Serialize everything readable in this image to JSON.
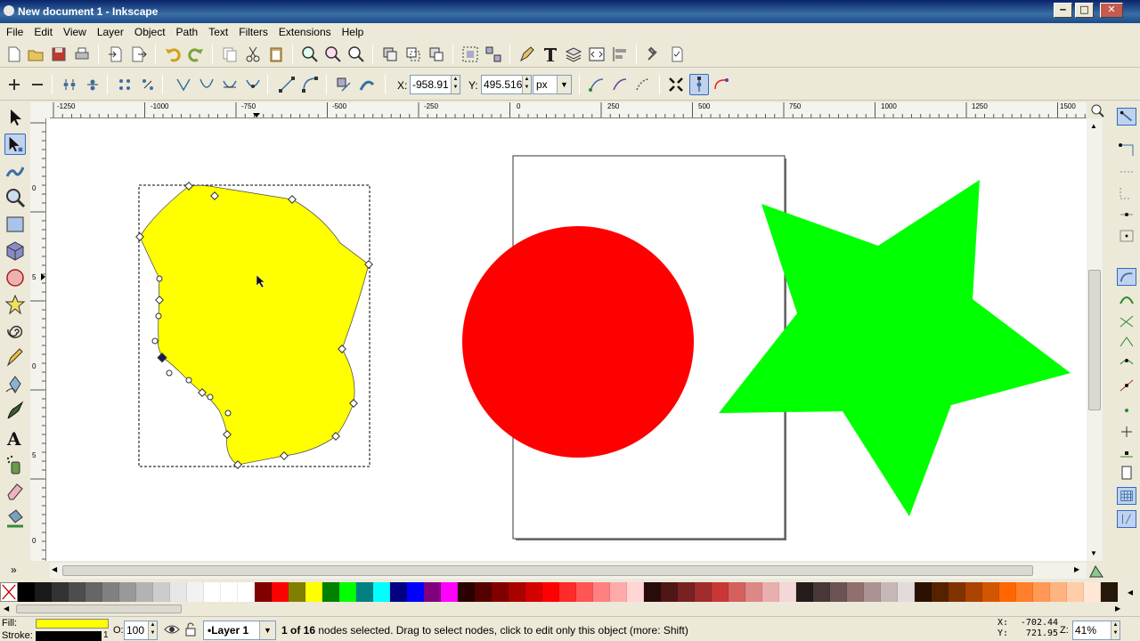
{
  "window": {
    "title": "New document 1 - Inkscape"
  },
  "menu": [
    "File",
    "Edit",
    "View",
    "Layer",
    "Object",
    "Path",
    "Text",
    "Filters",
    "Extensions",
    "Help"
  ],
  "node_toolbar": {
    "x_label": "X:",
    "x_value": "-958.91",
    "y_label": "Y:",
    "y_value": "495.516",
    "unit": "px"
  },
  "rulers": {
    "top_ticks": [
      "-1250",
      "-1000",
      "-750",
      "-500",
      "-250",
      "0",
      "250",
      "500",
      "750",
      "1000",
      "1250",
      "1500"
    ],
    "left_ticks": [
      "0",
      "5",
      "0",
      "5",
      "0"
    ]
  },
  "colors": {
    "yellow_shape": "#ffff00",
    "circle": "#ff0000",
    "star": "#00ff00",
    "selection": "#316ac5"
  },
  "palette": [
    "#000000",
    "#1a1a1a",
    "#333333",
    "#4d4d4d",
    "#666666",
    "#808080",
    "#999999",
    "#b3b3b3",
    "#cccccc",
    "#e6e6e6",
    "#f2f2f2",
    "#ffffff",
    "#ffffff",
    "#ffffff",
    "#800000",
    "#ff0000",
    "#808000",
    "#ffff00",
    "#008000",
    "#00ff00",
    "#008080",
    "#00ffff",
    "#000080",
    "#0000ff",
    "#800080",
    "#ff00ff",
    "#2b0000",
    "#550000",
    "#800000",
    "#aa0000",
    "#d40000",
    "#ff0000",
    "#ff2a2a",
    "#ff5555",
    "#ff8080",
    "#ffaaaa",
    "#ffd5d5",
    "#280b0b",
    "#501616",
    "#782121",
    "#a02c2c",
    "#c83737",
    "#d35f5f",
    "#de8787",
    "#e9afaf",
    "#f4d7d7",
    "#241c1c",
    "#483737",
    "#6c5353",
    "#916f6f",
    "#ac9393",
    "#c8b7b7",
    "#e3dbdb",
    "#2b1100",
    "#552200",
    "#803300",
    "#aa4400",
    "#d45500",
    "#ff6600",
    "#ff7f2a",
    "#ff9955",
    "#ffb380",
    "#ffccaa",
    "#ffe6d5",
    "#28170b"
  ],
  "status": {
    "fill_label": "Fill:",
    "stroke_label": "Stroke:",
    "fill_color": "#ffff00",
    "stroke_color": "#000000",
    "stroke_width": "1",
    "opacity_label": "O:",
    "opacity_value": "100",
    "layer": "•Layer 1",
    "message_bold": "1 of 16",
    "message_rest": " nodes selected. Drag to select nodes, click to edit only this object (more: Shift)",
    "cursor_x_label": "X:",
    "cursor_x": "-702.44",
    "cursor_y_label": "Y:",
    "cursor_y": "721.95",
    "zoom_label": "Z:",
    "zoom": "41%"
  }
}
